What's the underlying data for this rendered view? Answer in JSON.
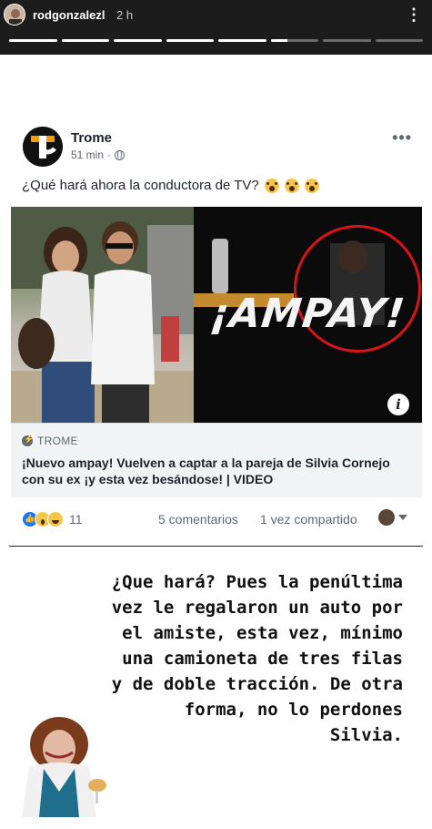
{
  "story": {
    "username": "rodgonzalezl",
    "time": "2 h",
    "more_icon": "ellipsis-vertical-icon",
    "progress": [
      1,
      1,
      1,
      1,
      1,
      0.35,
      0,
      0
    ]
  },
  "post": {
    "page_name": "Trome",
    "time": "51 min",
    "meta_separator": "·",
    "privacy_icon": "globe-icon",
    "text": "¿Qué hará ahora la conductora de TV?",
    "text_emoji": [
      "face-screaming-icon",
      "face-screaming-icon",
      "face-screaming-icon"
    ],
    "image_overlay_text": "¡AMPAY!",
    "info_symbol": "i",
    "link": {
      "domain": "TROME",
      "title": "¡Nuevo ampay! Vuelven a captar a la pareja de Silvia Cornejo con su ex ¡y esta vez besándose! | VIDEO"
    },
    "reactions": {
      "types": [
        "like",
        "wow",
        "haha"
      ],
      "count": "11"
    },
    "comments": "5 comentarios",
    "shares": "1 vez compartido"
  },
  "caption": {
    "lines": [
      "¿Que hará? Pues la penúltima",
      "vez le regalaron un auto por",
      "el amiste, esta vez, mínimo",
      "una camioneta de tres filas",
      "y de doble tracción. De otra",
      "forma, no lo perdones",
      "Silvia."
    ]
  },
  "colors": {
    "story_bar": "#1c1c1c",
    "fb_blue": "#1877f2",
    "ampay_circle": "#d4151a",
    "meta_gray": "#606770",
    "link_box": "#f2f3f5"
  }
}
